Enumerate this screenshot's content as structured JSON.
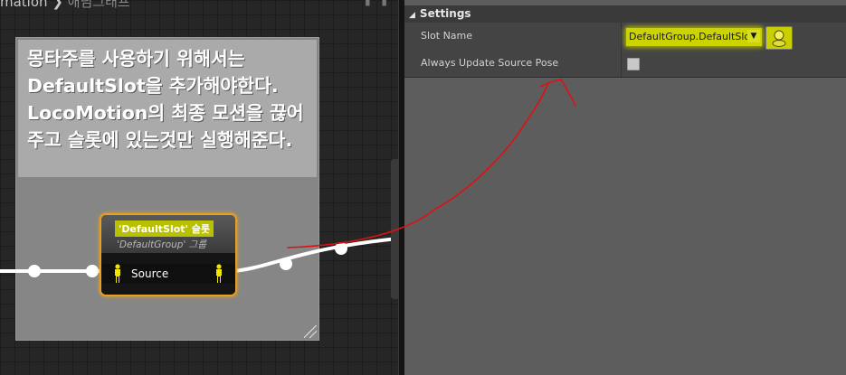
{
  "breadcrumb": {
    "part1": "mation",
    "separator": "❯",
    "part2": "애님그래프"
  },
  "comment": {
    "text": "몽타주를 사용하기 위해서는 DefaultSlot을 추가해야한다. LocoMotion의 최종 모션을 끊어주고 슬롯에 있는것만 실행해준다."
  },
  "slot_node": {
    "title": "'DefaultSlot' 슬롯",
    "subtitle": "'DefaultGroup' 그룹",
    "pin_label": "Source"
  },
  "details": {
    "section_title": "Settings",
    "slot_name_label": "Slot Name",
    "slot_name_value": "DefaultGroup.DefaultSlot",
    "always_update_label": "Always Update Source Pose",
    "always_update_checked": false
  },
  "colors": {
    "node_border": "#e8a020",
    "highlight": "#cbd400",
    "annotation": "#e01010"
  }
}
